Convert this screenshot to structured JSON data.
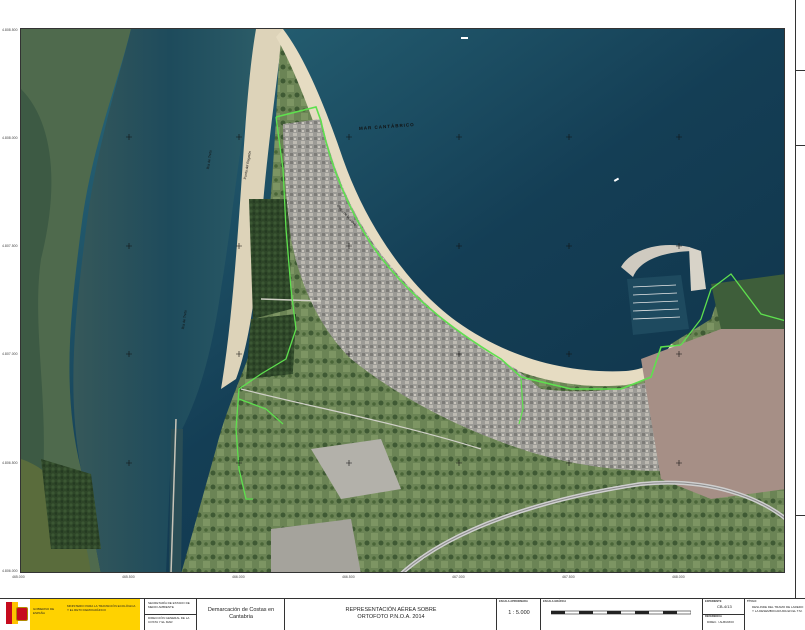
{
  "map": {
    "water_color": "#1b4a5c",
    "land_color": "#5d7a4a",
    "beach_color": "#e4dcc6",
    "urban_color": "#a9a7a2",
    "boundary_color": "#55e04a",
    "labels": {
      "sea": "MAR CANTÁBRICO",
      "beach": "Playa de la Salvé",
      "beach2": "Punta del Regatón",
      "ria": "Ría de Treto",
      "ria2": "Ría de Treto"
    },
    "x_coords": [
      "465.000",
      "465.500",
      "466.000",
      "466.500",
      "467.000",
      "467.500",
      "468.000"
    ],
    "y_coords": [
      "4.808.500",
      "4.808.000",
      "4.807.500",
      "4.807.000",
      "4.806.500",
      "4.806.000"
    ]
  },
  "title_block": {
    "gov1": "GOBIERNO DE ESPAÑA",
    "ministry": "MINISTERIO PARA LA TRANSICIÓN ECOLÓGICA Y EL RETO DEMOGRÁFICO",
    "sec1": "SECRETARÍA DE ESTADO DE MEDIO AMBIENTE",
    "sec2": "DIRECCIÓN GENERAL DE LA COSTA Y EL MAR",
    "office": "Demarcación de Costas en Cantabria",
    "title": "REPRESENTACIÓN AÉREA SOBRE ORTOFOTO P.N.O.A. 2014",
    "scale_label": "ESCALA APROXIMADA",
    "scale": "1 : 5.000",
    "graphic_scale_label": "ESCALA GRÁFICA",
    "expediente_label": "EXPEDIENTE",
    "expediente": "CB-4/13",
    "ref_label": "REFERENCIA",
    "ref": "DIREC. / ALBURDO",
    "desc_label": "TÍTULO",
    "desc": "DESLINDE DEL TRAMO DE LAREDO Y LA DESEMBOCADURA EN EL T.M."
  }
}
